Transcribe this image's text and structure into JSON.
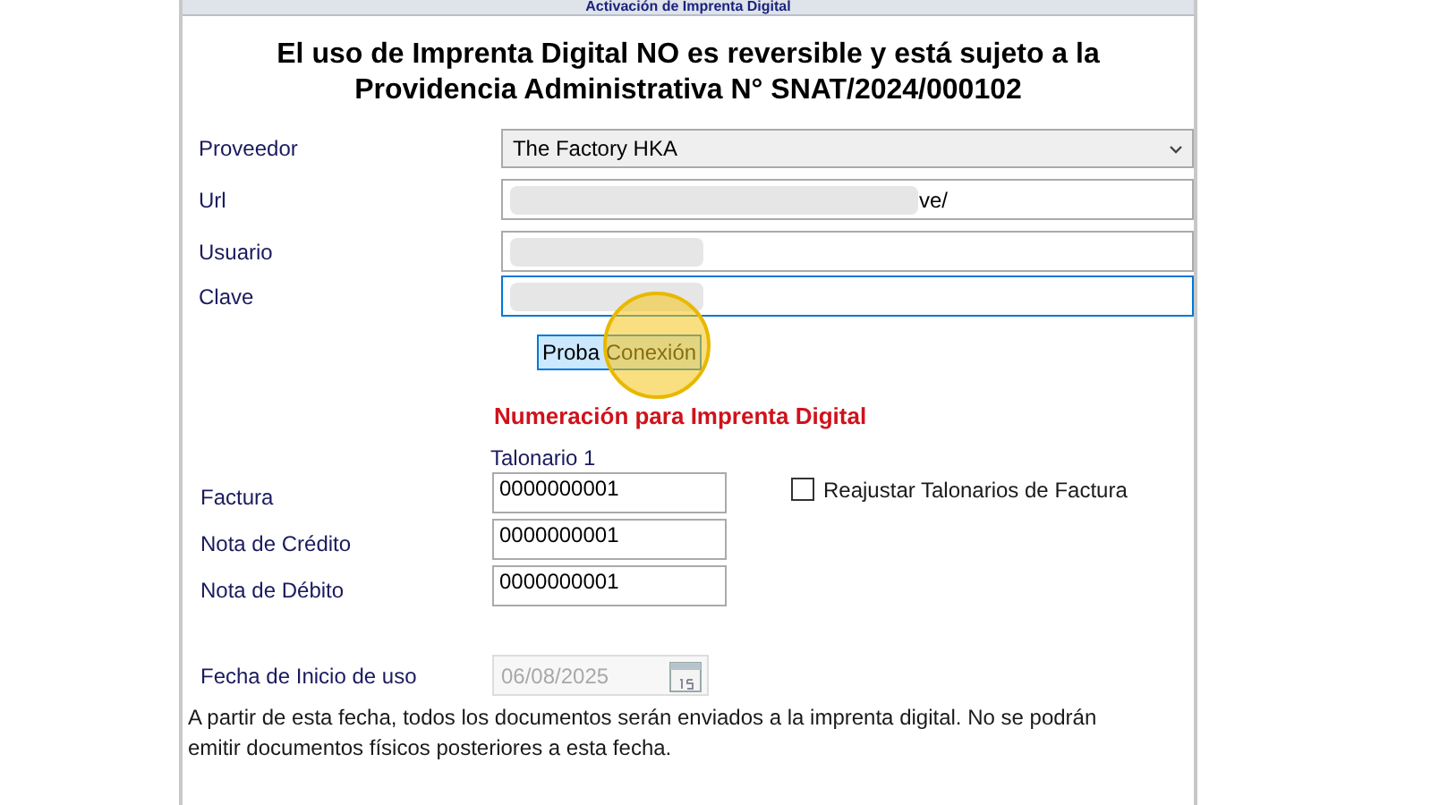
{
  "window": {
    "title": "Activación de Imprenta Digital"
  },
  "notice": [
    "El uso de Imprenta Digital NO es reversible y está sujeto a la",
    "Providencia Administrativa N° SNAT/2024/000102"
  ],
  "connection_fields": [
    {
      "kind": "dropdown",
      "label": "Proveedor",
      "value": "The Factory HKA",
      "focused": false
    },
    {
      "kind": "text",
      "label": "Url",
      "value": "ve/",
      "redacted": true,
      "focused": false
    },
    {
      "kind": "text",
      "label": "Usuario",
      "redacted": true,
      "focused": false
    },
    {
      "kind": "text",
      "label": "Clave",
      "redacted": true,
      "focused": true
    }
  ],
  "test_button": {
    "label_parts": [
      "Proba",
      "Conexión"
    ]
  },
  "numbering": {
    "title": "Numeración para Imprenta Digital",
    "column": "Talonario 1",
    "rows": [
      {
        "label": "Factura",
        "value": "0000000001"
      },
      {
        "label": "Nota de Crédito",
        "value": "0000000001"
      },
      {
        "label": "Nota de Débito",
        "value": "0000000001"
      }
    ],
    "readjust": {
      "label": "Reajustar Talonarios de Factura",
      "checked": false
    }
  },
  "start_date": {
    "label": "Fecha de Inicio de uso",
    "value": "06/08/2025",
    "disabled": true
  },
  "footer_note": "A partir de esta fecha, todos los documentos serán enviados a la imprenta digital.  No se podrán emitir documentos físicos posteriores a esta fecha."
}
